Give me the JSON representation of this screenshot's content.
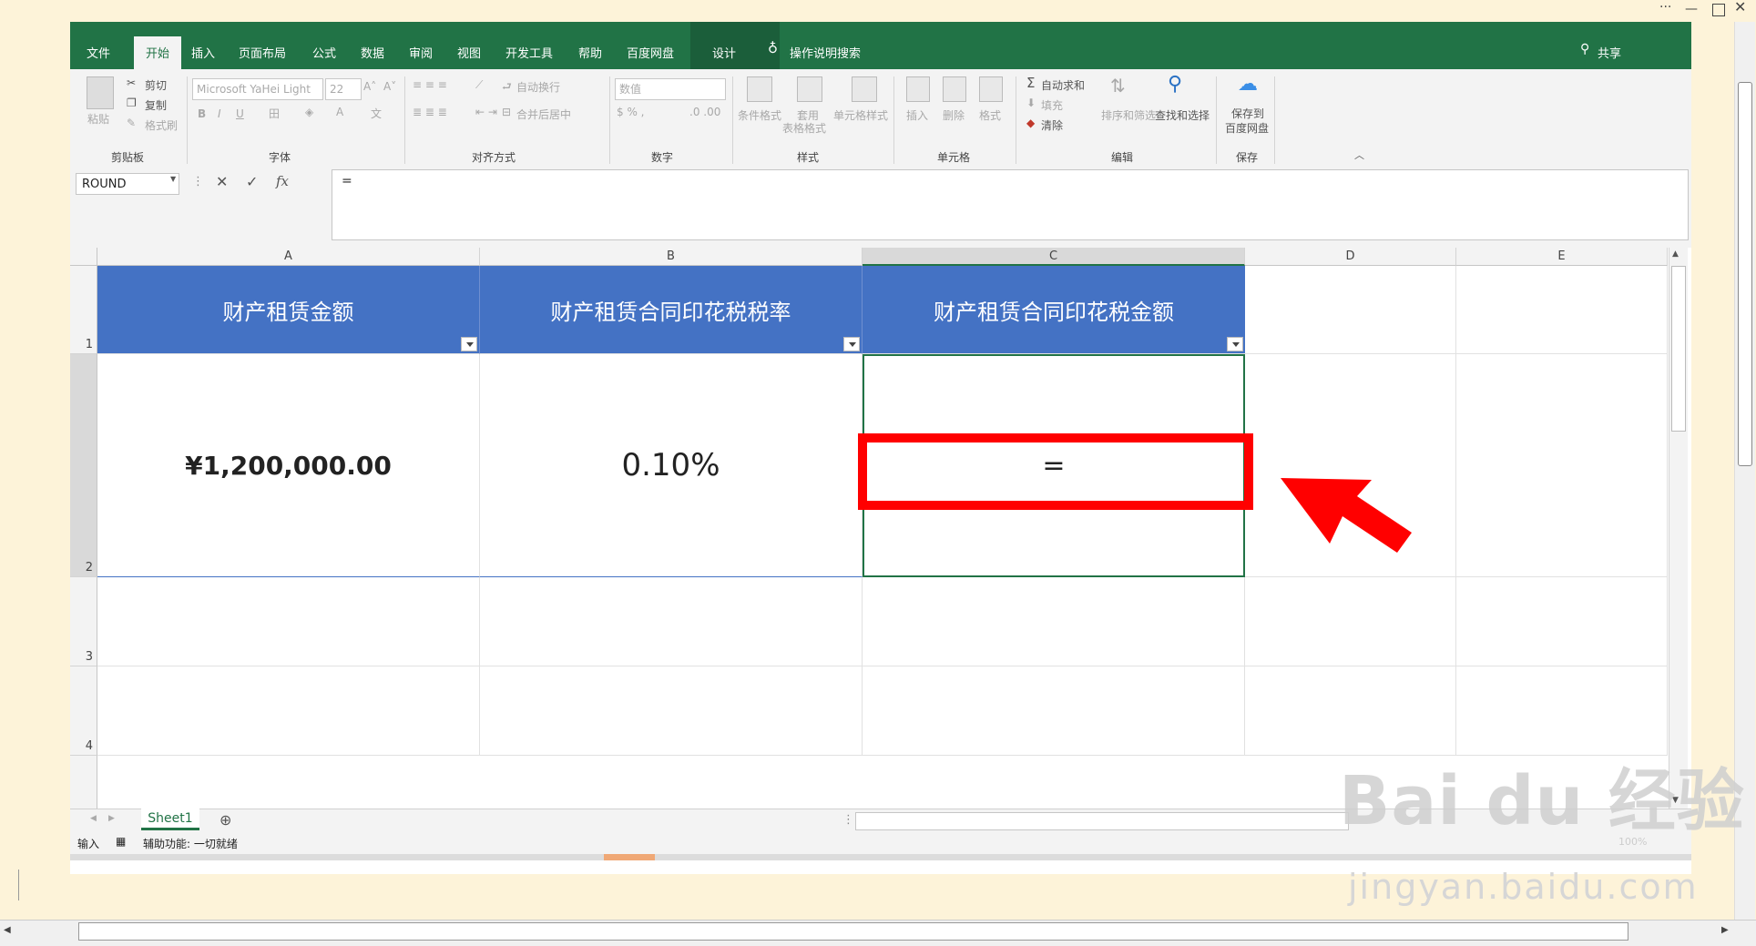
{
  "menu": {
    "file": "文件",
    "home": "开始",
    "insert": "插入",
    "layout": "页面布局",
    "formulas": "公式",
    "data": "数据",
    "review": "审阅",
    "view": "视图",
    "developer": "开发工具",
    "help": "帮助",
    "baidu": "百度网盘",
    "design": "设计",
    "search": "操作说明搜索",
    "share": "共享"
  },
  "ribbon": {
    "paste": "粘贴",
    "cut": "剪切",
    "copy": "复制",
    "format_painter": "格式刷",
    "clipboard": "剪贴板",
    "font_name": "Microsoft YaHei Light",
    "font_size": "22",
    "font_group": "字体",
    "wrap_text": "自动换行",
    "merge_center": "合并后居中",
    "alignment": "对齐方式",
    "number_format": "数值",
    "number": "数字",
    "conditional": "条件格式",
    "table_format_1": "套用",
    "table_format_2": "表格格式",
    "cell_styles": "单元格样式",
    "styles": "样式",
    "insert": "插入",
    "delete": "删除",
    "format": "格式",
    "cells": "单元格",
    "autosum": "自动求和",
    "fill": "填充",
    "clear": "清除",
    "sort_filter": "排序和筛选",
    "find_select": "查找和选择",
    "editing": "编辑",
    "save_to_1": "保存到",
    "save_to_2": "百度网盘",
    "save": "保存"
  },
  "formula_bar": {
    "name_box": "ROUND",
    "formula": "="
  },
  "columns": [
    "A",
    "B",
    "C",
    "D",
    "E"
  ],
  "rows": [
    "1",
    "2",
    "3",
    "4"
  ],
  "table": {
    "headers": [
      "财产租赁金额",
      "财产租赁合同印花税税率",
      "财产租赁合同印花税金额"
    ],
    "row2": [
      "¥1,200,000.00",
      "0.10%",
      "="
    ]
  },
  "sheet": {
    "tab": "Sheet1"
  },
  "status": {
    "mode": "输入",
    "accessibility": "辅助功能: 一切就绪",
    "zoom": "100%"
  },
  "watermark": {
    "brand": "Bai du 经验",
    "url": "jingyan.baidu.com"
  },
  "colors": {
    "excel_green": "#217346",
    "header_blue": "#4472c4",
    "annotation_red": "#ff0000"
  }
}
